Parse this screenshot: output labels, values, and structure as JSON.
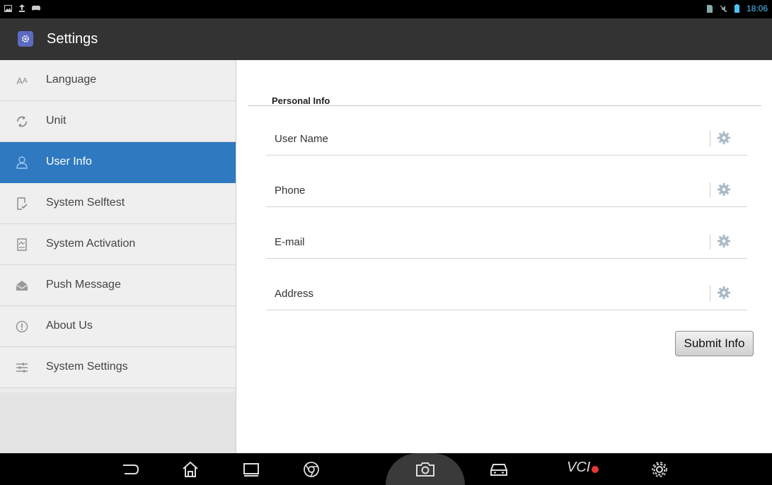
{
  "status_bar": {
    "time": "18:06",
    "left_icons": [
      "image-icon",
      "upload-icon",
      "game-controller-icon"
    ],
    "right_icons": [
      "sim-icon",
      "mute-icon",
      "battery-icon"
    ]
  },
  "app_bar": {
    "title": "Settings",
    "icon": "settings-app-icon"
  },
  "sidebar": {
    "items": [
      {
        "label": "Language",
        "icon": "font-size-icon",
        "active": false
      },
      {
        "label": "Unit",
        "icon": "convert-icon",
        "active": false
      },
      {
        "label": "User Info",
        "icon": "user-icon",
        "active": true
      },
      {
        "label": "System Selftest",
        "icon": "document-check-icon",
        "active": false
      },
      {
        "label": "System Activation",
        "icon": "activation-icon",
        "active": false
      },
      {
        "label": "Push Message",
        "icon": "envelope-icon",
        "active": false
      },
      {
        "label": "About Us",
        "icon": "info-icon",
        "active": false
      },
      {
        "label": "System Settings",
        "icon": "sliders-icon",
        "active": false
      }
    ]
  },
  "content": {
    "section_title": "Personal Info",
    "fields": [
      {
        "label": "User Name",
        "icon": "gear-icon"
      },
      {
        "label": "Phone",
        "icon": "gear-icon"
      },
      {
        "label": "E-mail",
        "icon": "gear-icon"
      },
      {
        "label": "Address",
        "icon": "gear-icon"
      }
    ],
    "submit_label": "Submit Info"
  },
  "nav_bar": {
    "buttons": [
      "back-icon",
      "home-icon",
      "recent-apps-icon",
      "browser-icon",
      "camera-icon",
      "car-icon",
      "vci-icon",
      "settings-gear-icon"
    ],
    "vci_label": "VCI"
  },
  "colors": {
    "accent": "#2f79c0",
    "app_bar": "#333333",
    "status_time": "#4fc3f7"
  }
}
